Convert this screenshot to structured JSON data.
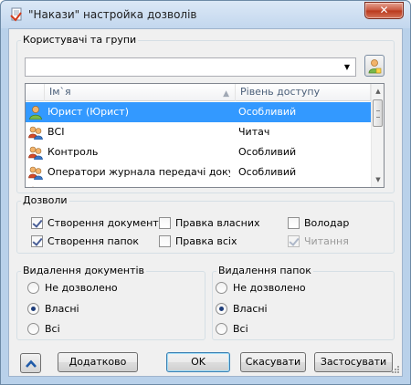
{
  "window": {
    "title": "\"Накази\" настройка дозволів",
    "close_glyph": "✕"
  },
  "users_group": {
    "label": "Користувачі та групи",
    "combo_value": "",
    "columns": {
      "name": "Ім`я",
      "level": "Рівень доступу"
    },
    "rows": [
      {
        "name": "Юрист (Юрист)",
        "level": "Особливий",
        "icon": "single-user-icon",
        "selected": true
      },
      {
        "name": "ВСІ",
        "level": "Читач",
        "icon": "group-icon",
        "selected": false
      },
      {
        "name": "Контроль",
        "level": "Особливий",
        "icon": "group-icon",
        "selected": false
      },
      {
        "name": "Оператори журнала передачі докуме...",
        "level": "Особливий",
        "icon": "group-icon",
        "selected": false
      }
    ]
  },
  "permissions": {
    "label": "Дозволи",
    "items": [
      {
        "label": "Створення документів",
        "checked": true,
        "enabled": true
      },
      {
        "label": "Правка власних",
        "checked": false,
        "enabled": true
      },
      {
        "label": "Володар",
        "checked": false,
        "enabled": true
      },
      {
        "label": "Створення папок",
        "checked": true,
        "enabled": true
      },
      {
        "label": "Правка всіх",
        "checked": false,
        "enabled": true
      },
      {
        "label": "Читання",
        "checked": true,
        "enabled": false
      }
    ]
  },
  "delete_documents": {
    "label": "Видалення документів",
    "options": [
      "Не дозволено",
      "Власні",
      "Всі"
    ],
    "selected": "Власні"
  },
  "delete_folders": {
    "label": "Видалення папок",
    "options": [
      "Не дозволено",
      "Власні",
      "Всі"
    ],
    "selected": "Власні"
  },
  "buttons": {
    "more": "Додатково",
    "ok": "OK",
    "cancel": "Скасувати",
    "apply": "Застосувати"
  },
  "colors": {
    "selection": "#3399ff",
    "frame": "#b9d1ea",
    "close": "#c7543b"
  }
}
